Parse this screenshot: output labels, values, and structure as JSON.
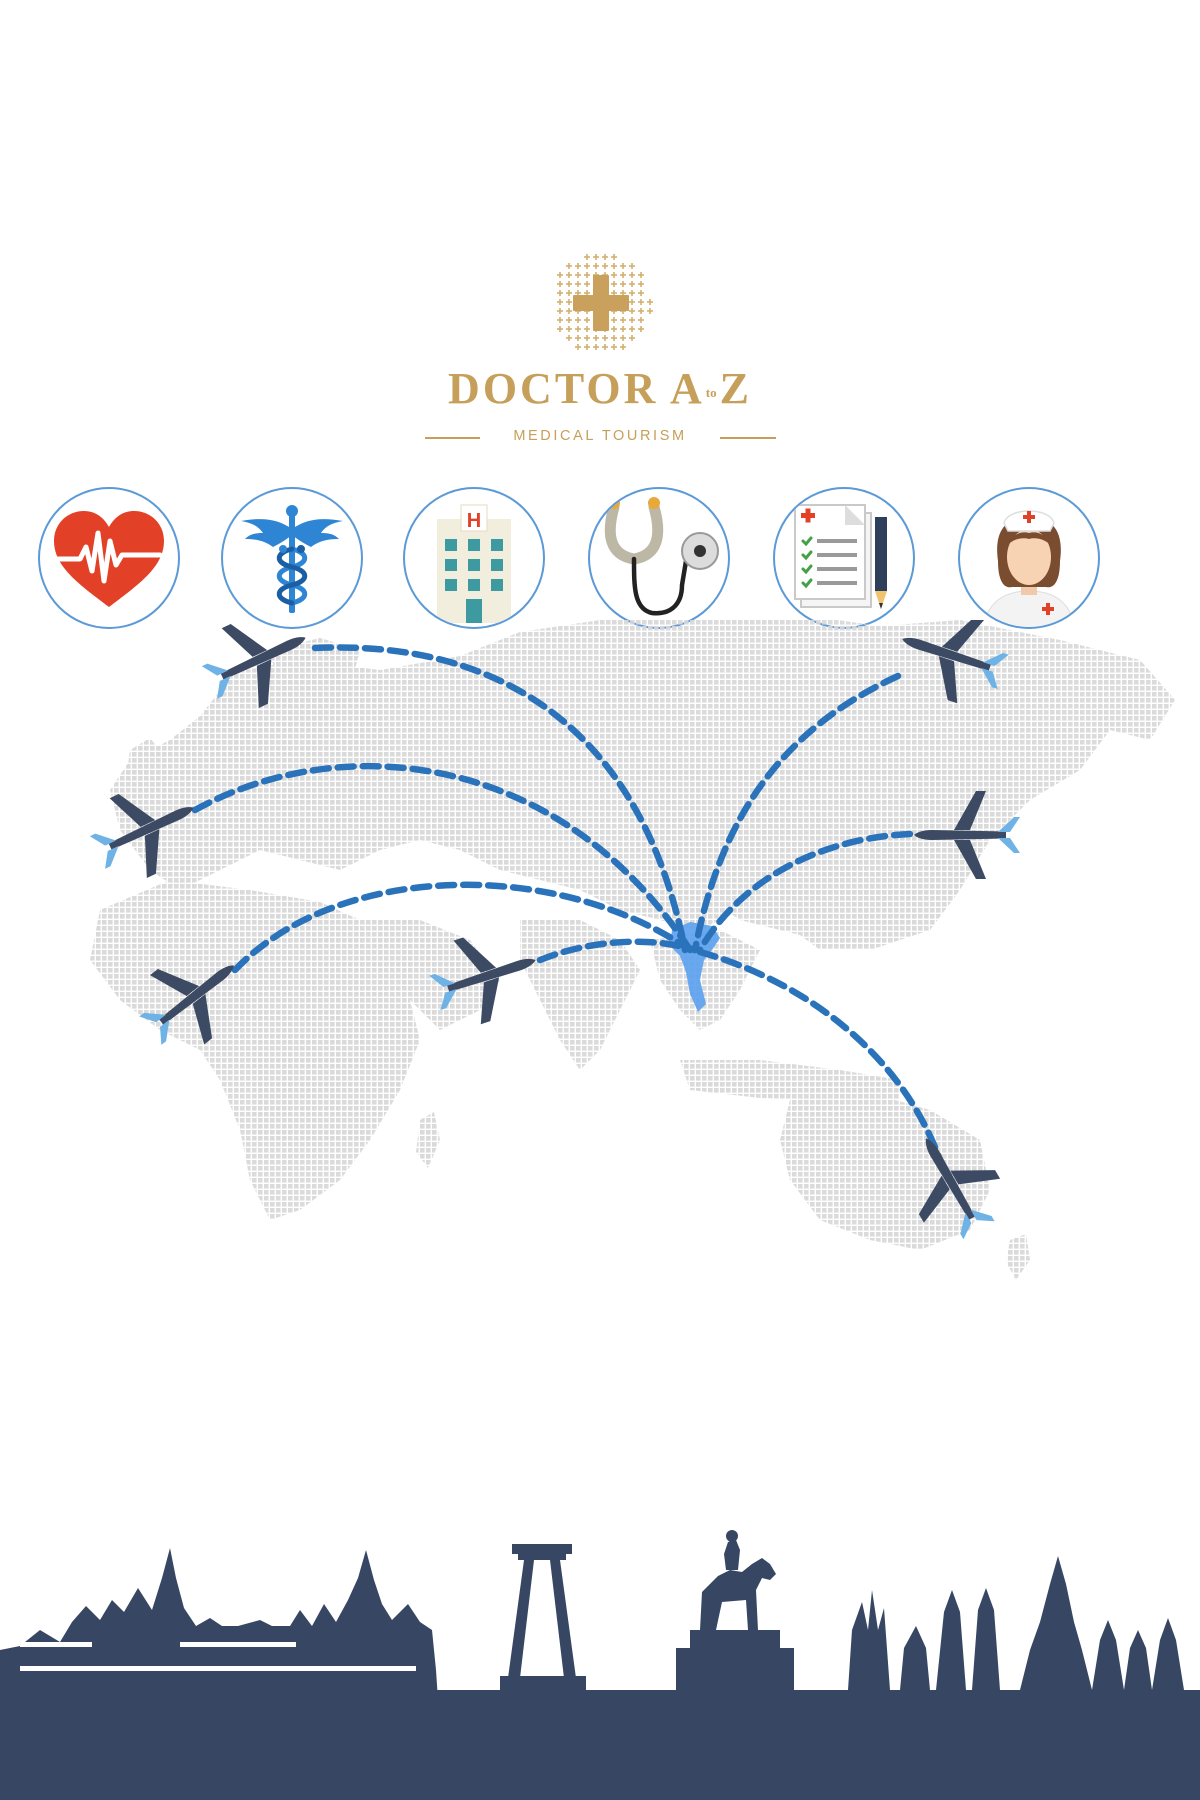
{
  "brand": {
    "name_part1": "DOCTOR A",
    "name_to": "TO",
    "name_part2": "Z",
    "tagline": "MEDICAL TOURISM",
    "color": "#c6a05a"
  },
  "icons": [
    {
      "name": "heartbeat-icon"
    },
    {
      "name": "caduceus-icon"
    },
    {
      "name": "hospital-icon"
    },
    {
      "name": "stethoscope-icon"
    },
    {
      "name": "medical-report-icon"
    },
    {
      "name": "nurse-icon"
    }
  ],
  "map": {
    "destination": "Thailand",
    "route_color": "#2a73bb",
    "plane_color": "#3d4a63",
    "plane_tail_color": "#6fb2e6",
    "destination_color": "#5aa0ee"
  },
  "skyline": {
    "color": "#374763"
  }
}
